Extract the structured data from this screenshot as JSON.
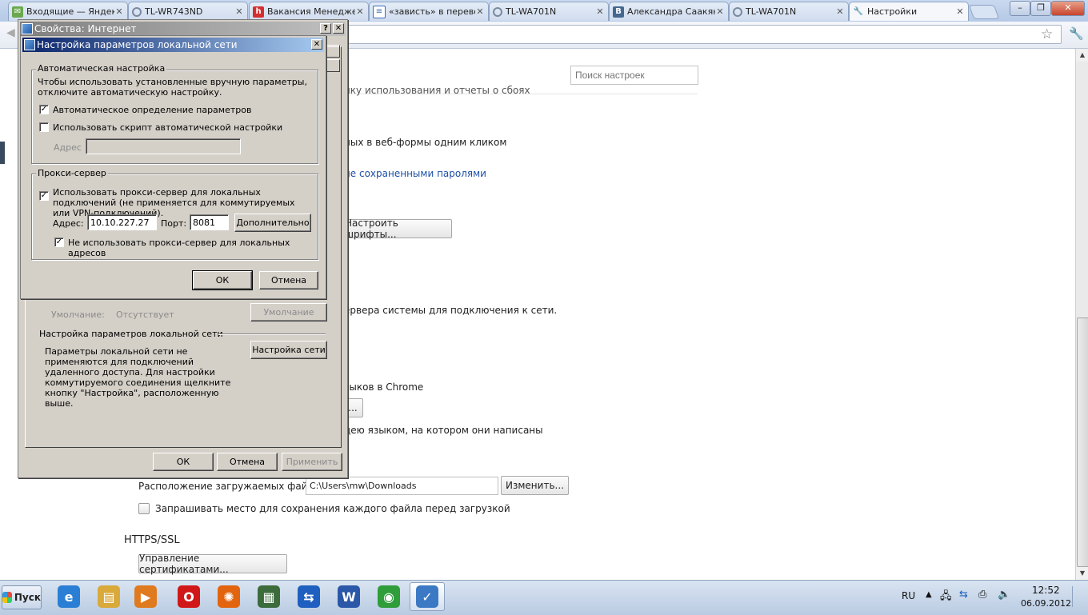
{
  "tabs": [
    {
      "label": "Входящие — Яндекс",
      "icon": "mail-icon",
      "color": "#6aa84f"
    },
    {
      "label": "TL-WR743ND",
      "icon": "loading-icon",
      "color": "#7a8aa0"
    },
    {
      "label": "Вакансия Менеджер",
      "icon": "hh-icon",
      "color": "#d32f2f"
    },
    {
      "label": "«зависть» в перево",
      "icon": "page-icon",
      "color": "#3b6db5"
    },
    {
      "label": "TL-WA701N",
      "icon": "loading-icon",
      "color": "#7a8aa0"
    },
    {
      "label": "Александра Саакян",
      "icon": "vk-icon",
      "color": "#45688e"
    },
    {
      "label": "TL-WA701N",
      "icon": "loading-icon",
      "color": "#7a8aa0"
    },
    {
      "label": "Настройки",
      "icon": "wrench-icon",
      "color": "#555555"
    }
  ],
  "settings": {
    "search_placeholder": "Поиск настроек",
    "line_usage": "ику использования и отчеты о сбоях",
    "line_autofill": "ных в веб-формы одним кликом",
    "link_passwords": "ие сохраненными паролями",
    "btn_fonts": "Настроить шрифты...",
    "line_proxy": "ервера системы для подключения к сети.",
    "line_langs": "зыков в Chrome",
    "btn_lang_partial": "...",
    "line_translate": "дею языком, на котором они написаны",
    "download_label": "Расположение загружаемых файлов:",
    "download_path": "C:\\Users\\mw\\Downloads",
    "btn_change": "Изменить...",
    "ask_location": "Запрашивать место для сохранения каждого файла перед загрузкой",
    "https_title": "HTTPS/SSL",
    "btn_certs": "Управление сертификатами..."
  },
  "inet_props": {
    "title": "Свойства: Интернет",
    "default_label": "Умолчание:",
    "default_value": "Отсутствует",
    "btn_default": "Умолчание",
    "lan_section": "Настройка параметров локальной сети",
    "lan_desc": "Параметры локальной сети не применяются для подключений удаленного доступа. Для настройки коммутируемого соединения щелкните кнопку \"Настройка\", расположенную выше.",
    "btn_lan": "Настройка сети",
    "btn_ok": "ОК",
    "btn_cancel": "Отмена",
    "btn_apply": "Применить"
  },
  "lan_dialog": {
    "title": "Настройка параметров локальной сети",
    "auto_group": "Автоматическая настройка",
    "auto_desc": "Чтобы использовать установленные вручную параметры, отключите автоматическую настройку.",
    "auto_detect": "Автоматическое определение параметров",
    "auto_detect_checked": true,
    "use_script": "Использовать скрипт автоматической настройки",
    "use_script_checked": false,
    "script_addr_label": "Адрес",
    "proxy_group": "Прокси-сервер",
    "use_proxy": "Использовать прокси-сервер для локальных подключений (не применяется для коммутируемых или VPN-подключений).",
    "use_proxy_checked": true,
    "addr_label": "Адрес:",
    "addr_value": "10.10.227.27",
    "port_label": "Порт:",
    "port_value": "8081",
    "btn_advanced": "Дополнительно",
    "bypass_local": "Не использовать прокси-сервер для локальных адресов",
    "bypass_local_checked": true,
    "btn_ok": "ОК",
    "btn_cancel": "Отмена"
  },
  "taskbar": {
    "start": "Пуск",
    "lang": "RU",
    "time": "12:52",
    "date": "06.09.2012",
    "apps": [
      {
        "name": "ie-icon",
        "glyph": "e",
        "color": "#2a7fd4"
      },
      {
        "name": "folder-icon",
        "glyph": "▤",
        "color": "#d9a93a"
      },
      {
        "name": "media-player-icon",
        "glyph": "▶",
        "color": "#e07a1f"
      },
      {
        "name": "opera-icon",
        "glyph": "O",
        "color": "#d01818"
      },
      {
        "name": "firefox-icon",
        "glyph": "✺",
        "color": "#e2640e"
      },
      {
        "name": "window-app-icon",
        "glyph": "▦",
        "color": "#3c6b3c"
      },
      {
        "name": "teamviewer-icon",
        "glyph": "⇆",
        "color": "#1e5fbf"
      },
      {
        "name": "word-icon",
        "glyph": "W",
        "color": "#2b57a8"
      },
      {
        "name": "chrome-icon",
        "glyph": "◉",
        "color": "#2e9d3a"
      },
      {
        "name": "internet-options-icon",
        "glyph": "✓",
        "color": "#3b79c4"
      }
    ]
  }
}
